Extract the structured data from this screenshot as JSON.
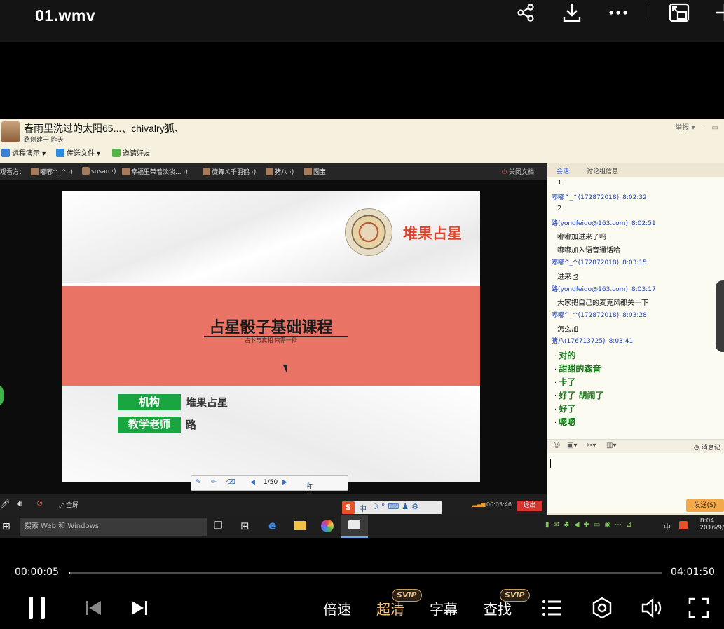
{
  "player": {
    "title": "01.wmv",
    "current_time": "00:00:05",
    "total_time": "04:01:50",
    "progress_fraction": 0.0002,
    "controls": {
      "speed": "倍速",
      "quality": "超清",
      "subtitles": "字幕",
      "search": "查找",
      "svip_badge": "SVIP"
    },
    "colors": {
      "quality_active": "#f0c27b",
      "badge_gold": "#e8c08a"
    }
  },
  "qq": {
    "group_title": "春雨里洗过的太阳65...、chivalry狐、",
    "creator_line": "路创建于 昨天",
    "toolbar": {
      "remote": "远程演示",
      "send_file": "传送文件",
      "invite": "邀请好友"
    },
    "report": "举报",
    "viewers_label": "观看方：",
    "viewers": [
      "嘟嘟^_^",
      "susan",
      "幸福里带着淡淡...",
      "旋舞ㄨ千羽鹤",
      "猪八",
      "圆宝"
    ],
    "close_doc": "关闭文档",
    "fullscreen": "全屏",
    "quit": "退出",
    "duration": "00:03:46",
    "ime": "中"
  },
  "slide": {
    "brand": "堆果占星",
    "course_title": "占星骰子基础课程",
    "course_subtitle": "占卜与真相 只需一秒",
    "org_label": "机构",
    "org_value": "堆果占星",
    "teacher_label": "教学老师",
    "teacher_value": "路",
    "page": "1/50",
    "whiteboard": "打开白板",
    "colors": {
      "band": "#e97466",
      "label_green": "#19a640",
      "brand_red": "#e0432c"
    }
  },
  "chat": {
    "tabs": [
      "会话",
      "讨论组信息"
    ],
    "messages": [
      {
        "text": "1"
      },
      {
        "who": "嘟嘟^_^(172872018)",
        "time": "8:02:32"
      },
      {
        "text": "2"
      },
      {
        "who": "路(yongfeido@163.com)",
        "time": "8:02:51"
      },
      {
        "text": "嘟嘟加进来了吗"
      },
      {
        "text": "嘟嘟加入语音通话哈"
      },
      {
        "who": "嘟嘟^_^(172872018)",
        "time": "8:03:15"
      },
      {
        "text": "进来也"
      },
      {
        "who": "路(yongfeido@163.com)",
        "time": "8:03:17"
      },
      {
        "text": "大家把自己的麦克风都关一下"
      },
      {
        "who": "嘟嘟^_^(172872018)",
        "time": "8:03:28"
      },
      {
        "text": "怎么加"
      },
      {
        "who": "猪八(176713725)",
        "time": "8:03:41"
      },
      {
        "big": "对的"
      },
      {
        "big": "甜甜的森音"
      },
      {
        "big": "卡了"
      },
      {
        "big": "好了 胡闹了"
      },
      {
        "big": "好了"
      },
      {
        "big": "嗯嗯"
      }
    ],
    "history": "消息记",
    "send": "发送(S)"
  },
  "taskbar": {
    "search_placeholder": "搜索 Web 和 Windows",
    "tray_ime": "中",
    "time": "8:04",
    "date": "2016/9/"
  }
}
